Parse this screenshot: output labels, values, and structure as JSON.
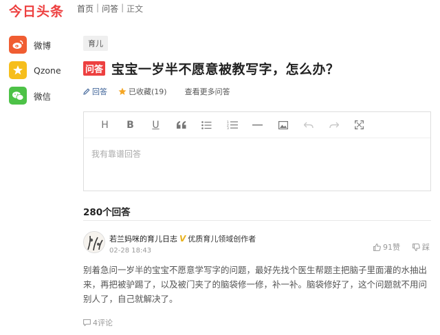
{
  "header": {
    "logo": "今日头条",
    "breadcrumb": [
      {
        "label": "首页"
      },
      {
        "label": "问答"
      },
      {
        "label": "正文"
      }
    ],
    "separator": "|"
  },
  "share": {
    "items": [
      {
        "label": "微博",
        "icon": "weibo-icon",
        "color": "#f05d32"
      },
      {
        "label": "Qzone",
        "icon": "qzone-icon",
        "color": "#f6be1c"
      },
      {
        "label": "微信",
        "icon": "wechat-icon",
        "color": "#4dc247"
      }
    ]
  },
  "question": {
    "tag": "育儿",
    "badge": "问答",
    "title": "宝宝一岁半不愿意被教写字，怎么办？",
    "actions": {
      "answer": "回答",
      "collected": "已收藏(19)",
      "more": "查看更多问答"
    }
  },
  "editor": {
    "toolbar": [
      "heading-icon",
      "bold-icon",
      "underline-icon",
      "quote-icon",
      "bullet-list-icon",
      "numbered-list-icon",
      "divider-icon",
      "image-icon",
      "undo-icon",
      "redo-icon",
      "fullscreen-icon"
    ],
    "placeholder": "我有靠谱回答"
  },
  "answers": {
    "count_label": "280个回答",
    "items": [
      {
        "author": "若兰妈咪的育儿日志",
        "verified_mark": "V",
        "author_desc": "优质育儿领域创作者",
        "time": "02-28 18:43",
        "likes": "91赞",
        "dislike": "踩",
        "body": "别着急问一岁半的宝宝不愿意学写字的问题，最好先找个医生帮题主把脑子里面灌的水抽出来，再把被驴踢了，以及被门夹了的脑袋修一修，补一补。脑袋修好了，这个问题就不用问别人了，自己就解决了。",
        "comments": "4评论"
      }
    ]
  },
  "colors": {
    "brand": "#ed4040",
    "link": "#406599",
    "star": "#f5a623"
  }
}
